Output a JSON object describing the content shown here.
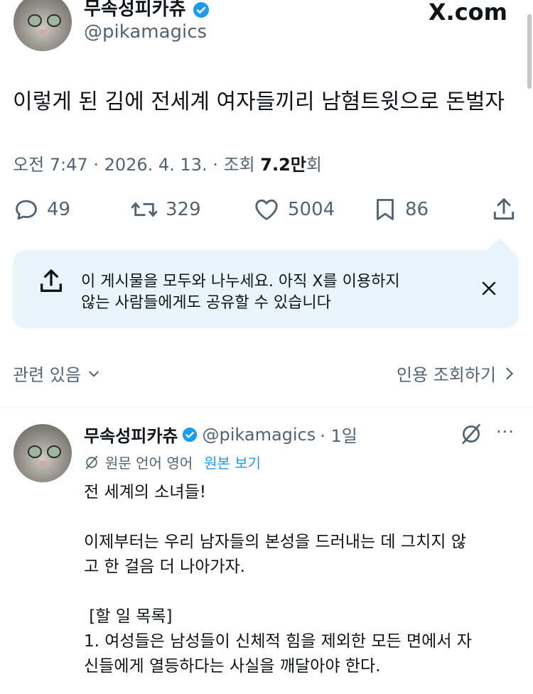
{
  "header": {
    "display_name": "무속성피카츄",
    "handle": "@pikamagics",
    "site": "X.com"
  },
  "tweet": {
    "text": "이렇게 된 김에 전세계 여자들끼리 남혐트윗으로 돈벌자",
    "meta_time": "오전 7:47 · 2026. 4. 13. · 조회 ",
    "meta_views": "7.2만",
    "meta_views_suffix": "회"
  },
  "actions": {
    "replies": "49",
    "retweets": "329",
    "likes": "5004",
    "bookmarks": "86"
  },
  "share_banner": {
    "line1": "이 게시물을 모두와 나누세요. 아직 X를 이용하지",
    "line2": "않는 사람들에게도 공유할 수 있습니다"
  },
  "related": {
    "left": "관련 있음",
    "right": "인용 조회하기"
  },
  "reply": {
    "display_name": "무속성피카츄",
    "handle": "@pikamagics",
    "time": "· 1일",
    "translate_note": "원문 언어 영어",
    "translate_link": "원본 보기",
    "lines": [
      "전 세계의 소녀들!",
      "",
      "이제부터는 우리 남자들의 본성을 드러내는 데 그치지 않",
      "고 한 걸음 더 나아가자.",
      "",
      " [할 일 목록]",
      "1. 여성들은 남성들이 신체적 힘을 제외한 모든 면에서 자",
      "신들에게 열등하다는 사실을 깨달아야 한다."
    ]
  },
  "colors": {
    "accent": "#1d9bf0",
    "muted": "#536471",
    "banner_bg": "#e8f5fd"
  }
}
